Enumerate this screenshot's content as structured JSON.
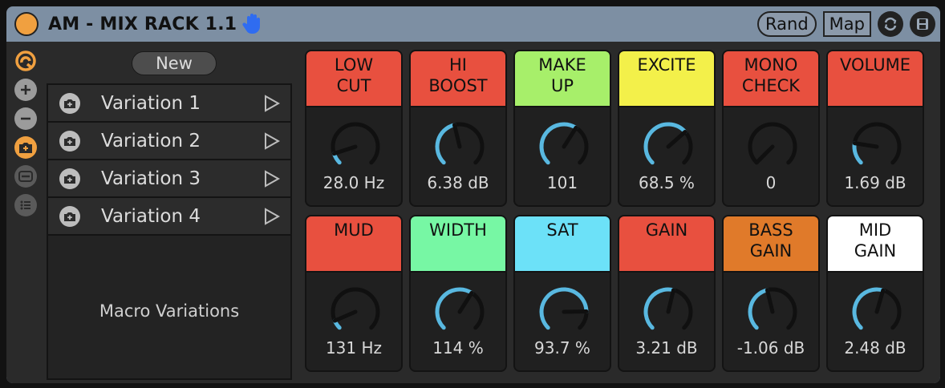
{
  "title": "AM - MIX RACK 1.1",
  "buttons": {
    "rand": "Rand",
    "map": "Map"
  },
  "variations": {
    "new_label": "New",
    "items": [
      "Variation 1",
      "Variation 2",
      "Variation 3",
      "Variation 4"
    ],
    "caption": "Macro Variations"
  },
  "macros": [
    {
      "name": "LOW\nCUT",
      "value": "28.0 Hz",
      "color": "#e8503f",
      "level": 0.1
    },
    {
      "name": "HI\nBOOST",
      "value": "6.38 dB",
      "color": "#e8503f",
      "level": 0.45
    },
    {
      "name": "MAKE\nUP",
      "value": "101",
      "color": "#a7ef6a",
      "level": 0.62
    },
    {
      "name": "EXCITE",
      "value": "68.5 %",
      "color": "#f3f04a",
      "level": 0.68
    },
    {
      "name": "MONO\nCHECK",
      "value": "0",
      "color": "#e8503f",
      "level": 0.0
    },
    {
      "name": "VOLUME",
      "value": "1.69 dB",
      "color": "#e8503f",
      "level": 0.2
    },
    {
      "name": "MUD",
      "value": "131 Hz",
      "color": "#e8503f",
      "level": 0.08
    },
    {
      "name": "WIDTH",
      "value": "114 %",
      "color": "#77f7a4",
      "level": 0.62
    },
    {
      "name": "SAT",
      "value": "93.7 %",
      "color": "#6ce1f8",
      "level": 0.83
    },
    {
      "name": "GAIN",
      "value": "3.21 dB",
      "color": "#e8503f",
      "level": 0.55
    },
    {
      "name": "BASS\nGAIN",
      "value": "-1.06 dB",
      "color": "#e07a2a",
      "level": 0.45
    },
    {
      "name": "MID\nGAIN",
      "value": "2.48 dB",
      "color": "#ffffff",
      "level": 0.56
    }
  ],
  "icons": {
    "power": "power-icon",
    "hand": "hand-icon",
    "refresh": "refresh-icon",
    "save": "save-icon",
    "side": [
      "chain-icon",
      "plus-icon",
      "minus-icon",
      "camera-icon",
      "minus-box-icon",
      "list-icon"
    ]
  },
  "colors": {
    "accent": "#f0a040",
    "arc": "#59b8e0",
    "titlebar": "#7d8fa3",
    "panel": "#2a2a2a"
  }
}
